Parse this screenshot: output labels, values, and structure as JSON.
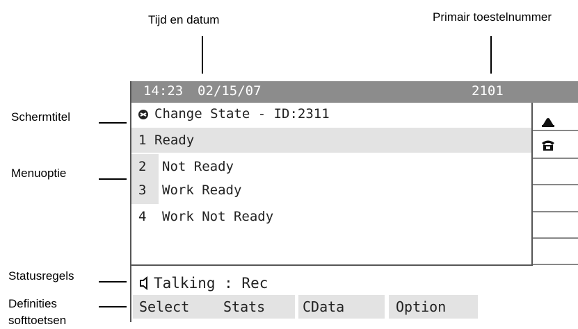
{
  "callouts": {
    "time_date": "Tijd en datum",
    "primary_number": "Primair toestelnummer",
    "screen_title": "Schermtitel",
    "menu_option": "Menuoptie",
    "status_lines": "Statusregels",
    "softkey_defs_line1": "Definities",
    "softkey_defs_line2": "softtoetsen"
  },
  "phone": {
    "time": "14:23",
    "date": "02/15/07",
    "extension": "2101",
    "title": "Change State - ID:2311",
    "title_icon": "agent-state-icon",
    "menu": [
      {
        "num": "1",
        "label": "Ready"
      },
      {
        "num": "2",
        "label": "Not Ready"
      },
      {
        "num": "3",
        "label": "Work Ready"
      },
      {
        "num": "4",
        "label": "Work Not Ready"
      }
    ],
    "status": {
      "icon": "speaker-icon",
      "text": "Talking : Rec"
    },
    "softkeys": [
      "Select",
      "Stats",
      "CData",
      "Option"
    ],
    "line_icons": [
      "handset-icon",
      "phone-icon"
    ]
  }
}
